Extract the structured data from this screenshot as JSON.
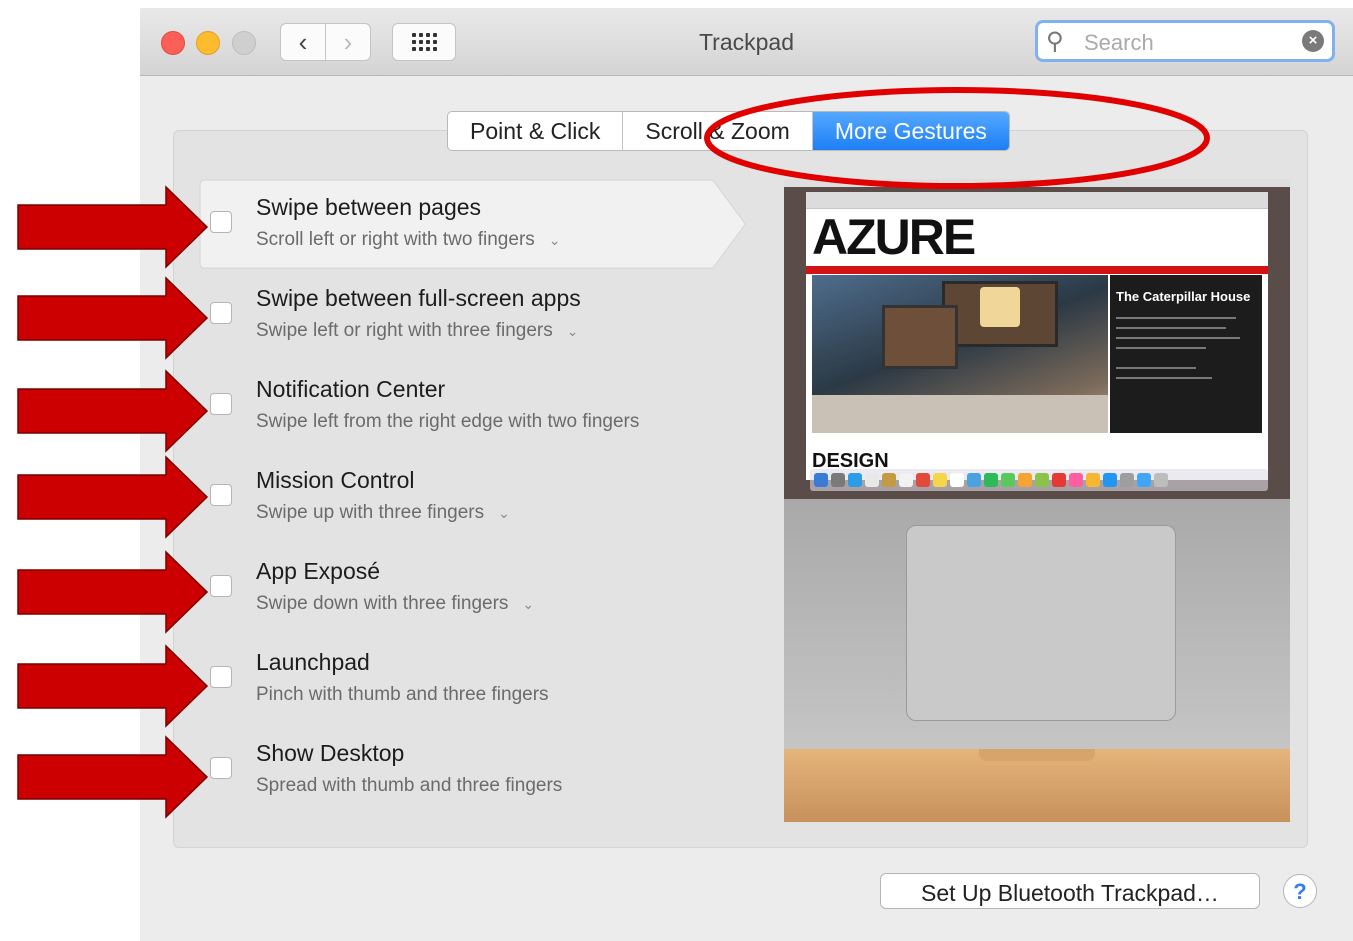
{
  "window": {
    "title": "Trackpad"
  },
  "toolbar": {
    "back_glyph": "‹",
    "forward_glyph": "›",
    "show_all_icon": "grid-icon"
  },
  "search": {
    "placeholder": "Search",
    "value": ""
  },
  "tabs": [
    {
      "label": "Point & Click",
      "active": false
    },
    {
      "label": "Scroll & Zoom",
      "active": false
    },
    {
      "label": "More Gestures",
      "active": true
    }
  ],
  "gestures": [
    {
      "title": "Swipe between pages",
      "subtitle": "Scroll left or right with two fingers",
      "has_menu": true,
      "checked": false,
      "selected": true
    },
    {
      "title": "Swipe between full-screen apps",
      "subtitle": "Swipe left or right with three fingers",
      "has_menu": true,
      "checked": false,
      "selected": false
    },
    {
      "title": "Notification Center",
      "subtitle": "Swipe left from the right edge with two fingers",
      "has_menu": false,
      "checked": false,
      "selected": false
    },
    {
      "title": "Mission Control",
      "subtitle": "Swipe up with three fingers",
      "has_menu": true,
      "checked": false,
      "selected": false
    },
    {
      "title": "App Exposé",
      "subtitle": "Swipe down with three fingers",
      "has_menu": true,
      "checked": false,
      "selected": false
    },
    {
      "title": "Launchpad",
      "subtitle": "Pinch with thumb and three fingers",
      "has_menu": false,
      "checked": false,
      "selected": false
    },
    {
      "title": "Show Desktop",
      "subtitle": "Spread with thumb and three fingers",
      "has_menu": false,
      "checked": false,
      "selected": false
    }
  ],
  "preview": {
    "site_logo": "AZURE",
    "article_title": "The Caterpillar House",
    "section_word": "DESIGN"
  },
  "footer": {
    "bluetooth_button": "Set Up Bluetooth Trackpad…",
    "help_label": "?"
  },
  "colors": {
    "accent": "#1d7ff5",
    "annotation_red": "#cc0000"
  }
}
